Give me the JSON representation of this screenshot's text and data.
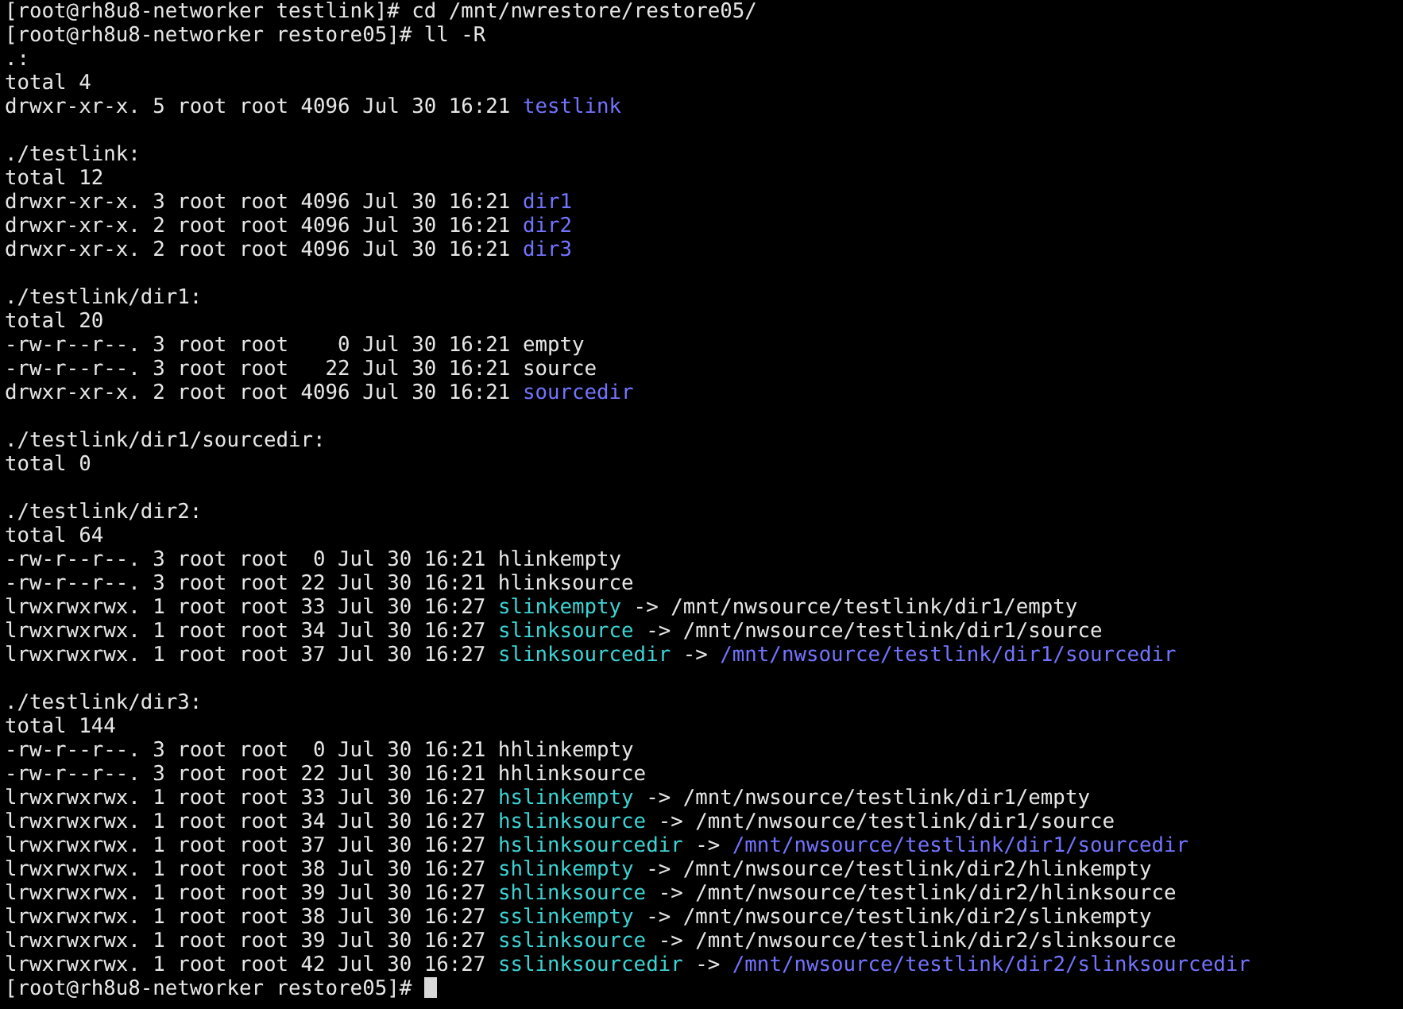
{
  "terminal": {
    "sections": [
      {
        "lines": [
          {
            "segments": [
              {
                "kind": "plain",
                "text": "[root@rh8u8-networker testlink]# cd /mnt/nwrestore/restore05/"
              }
            ]
          },
          {
            "segments": [
              {
                "kind": "plain",
                "text": "[root@rh8u8-networker restore05]# ll -R"
              }
            ]
          },
          {
            "segments": [
              {
                "kind": "plain",
                "text": ".:"
              }
            ]
          },
          {
            "segments": [
              {
                "kind": "plain",
                "text": "total 4"
              }
            ]
          },
          {
            "segments": [
              {
                "kind": "plain",
                "text": "drwxr-xr-x. 5 root root 4096 Jul 30 16:21 "
              },
              {
                "kind": "dir",
                "text": "testlink"
              }
            ]
          }
        ]
      },
      {
        "lines": [
          {
            "segments": [
              {
                "kind": "plain",
                "text": "./testlink:"
              }
            ]
          },
          {
            "segments": [
              {
                "kind": "plain",
                "text": "total 12"
              }
            ]
          },
          {
            "segments": [
              {
                "kind": "plain",
                "text": "drwxr-xr-x. 3 root root 4096 Jul 30 16:21 "
              },
              {
                "kind": "dir",
                "text": "dir1"
              }
            ]
          },
          {
            "segments": [
              {
                "kind": "plain",
                "text": "drwxr-xr-x. 2 root root 4096 Jul 30 16:21 "
              },
              {
                "kind": "dir",
                "text": "dir2"
              }
            ]
          },
          {
            "segments": [
              {
                "kind": "plain",
                "text": "drwxr-xr-x. 2 root root 4096 Jul 30 16:21 "
              },
              {
                "kind": "dir",
                "text": "dir3"
              }
            ]
          }
        ]
      },
      {
        "lines": [
          {
            "segments": [
              {
                "kind": "plain",
                "text": "./testlink/dir1:"
              }
            ]
          },
          {
            "segments": [
              {
                "kind": "plain",
                "text": "total 20"
              }
            ]
          },
          {
            "segments": [
              {
                "kind": "plain",
                "text": "-rw-r--r--. 3 root root    0 Jul 30 16:21 empty"
              }
            ]
          },
          {
            "segments": [
              {
                "kind": "plain",
                "text": "-rw-r--r--. 3 root root   22 Jul 30 16:21 source"
              }
            ]
          },
          {
            "segments": [
              {
                "kind": "plain",
                "text": "drwxr-xr-x. 2 root root 4096 Jul 30 16:21 "
              },
              {
                "kind": "dir",
                "text": "sourcedir"
              }
            ]
          }
        ]
      },
      {
        "lines": [
          {
            "segments": [
              {
                "kind": "plain",
                "text": "./testlink/dir1/sourcedir:"
              }
            ]
          },
          {
            "segments": [
              {
                "kind": "plain",
                "text": "total 0"
              }
            ]
          }
        ]
      },
      {
        "lines": [
          {
            "segments": [
              {
                "kind": "plain",
                "text": "./testlink/dir2:"
              }
            ]
          },
          {
            "segments": [
              {
                "kind": "plain",
                "text": "total 64"
              }
            ]
          },
          {
            "segments": [
              {
                "kind": "plain",
                "text": "-rw-r--r--. 3 root root  0 Jul 30 16:21 hlinkempty"
              }
            ]
          },
          {
            "segments": [
              {
                "kind": "plain",
                "text": "-rw-r--r--. 3 root root 22 Jul 30 16:21 hlinksource"
              }
            ]
          },
          {
            "segments": [
              {
                "kind": "plain",
                "text": "lrwxrwxrwx. 1 root root 33 Jul 30 16:27 "
              },
              {
                "kind": "link",
                "text": "slinkempty"
              },
              {
                "kind": "plain",
                "text": " -> /mnt/nwsource/testlink/dir1/empty"
              }
            ]
          },
          {
            "segments": [
              {
                "kind": "plain",
                "text": "lrwxrwxrwx. 1 root root 34 Jul 30 16:27 "
              },
              {
                "kind": "link",
                "text": "slinksource"
              },
              {
                "kind": "plain",
                "text": " -> /mnt/nwsource/testlink/dir1/source"
              }
            ]
          },
          {
            "segments": [
              {
                "kind": "plain",
                "text": "lrwxrwxrwx. 1 root root 37 Jul 30 16:27 "
              },
              {
                "kind": "link",
                "text": "slinksourcedir"
              },
              {
                "kind": "plain",
                "text": " -> "
              },
              {
                "kind": "dir",
                "text": "/mnt/nwsource/testlink/dir1/sourcedir"
              }
            ]
          }
        ]
      },
      {
        "lines": [
          {
            "segments": [
              {
                "kind": "plain",
                "text": "./testlink/dir3:"
              }
            ]
          },
          {
            "segments": [
              {
                "kind": "plain",
                "text": "total 144"
              }
            ]
          },
          {
            "segments": [
              {
                "kind": "plain",
                "text": "-rw-r--r--. 3 root root  0 Jul 30 16:21 hhlinkempty"
              }
            ]
          },
          {
            "segments": [
              {
                "kind": "plain",
                "text": "-rw-r--r--. 3 root root 22 Jul 30 16:21 hhlinksource"
              }
            ]
          },
          {
            "segments": [
              {
                "kind": "plain",
                "text": "lrwxrwxrwx. 1 root root 33 Jul 30 16:27 "
              },
              {
                "kind": "link",
                "text": "hslinkempty"
              },
              {
                "kind": "plain",
                "text": " -> /mnt/nwsource/testlink/dir1/empty"
              }
            ]
          },
          {
            "segments": [
              {
                "kind": "plain",
                "text": "lrwxrwxrwx. 1 root root 34 Jul 30 16:27 "
              },
              {
                "kind": "link",
                "text": "hslinksource"
              },
              {
                "kind": "plain",
                "text": " -> /mnt/nwsource/testlink/dir1/source"
              }
            ]
          },
          {
            "segments": [
              {
                "kind": "plain",
                "text": "lrwxrwxrwx. 1 root root 37 Jul 30 16:27 "
              },
              {
                "kind": "link",
                "text": "hslinksourcedir"
              },
              {
                "kind": "plain",
                "text": " -> "
              },
              {
                "kind": "dir",
                "text": "/mnt/nwsource/testlink/dir1/sourcedir"
              }
            ]
          },
          {
            "segments": [
              {
                "kind": "plain",
                "text": "lrwxrwxrwx. 1 root root 38 Jul 30 16:27 "
              },
              {
                "kind": "link",
                "text": "shlinkempty"
              },
              {
                "kind": "plain",
                "text": " -> /mnt/nwsource/testlink/dir2/hlinkempty"
              }
            ]
          },
          {
            "segments": [
              {
                "kind": "plain",
                "text": "lrwxrwxrwx. 1 root root 39 Jul 30 16:27 "
              },
              {
                "kind": "link",
                "text": "shlinksource"
              },
              {
                "kind": "plain",
                "text": " -> /mnt/nwsource/testlink/dir2/hlinksource"
              }
            ]
          },
          {
            "segments": [
              {
                "kind": "plain",
                "text": "lrwxrwxrwx. 1 root root 38 Jul 30 16:27 "
              },
              {
                "kind": "link",
                "text": "sslinkempty"
              },
              {
                "kind": "plain",
                "text": " -> /mnt/nwsource/testlink/dir2/slinkempty"
              }
            ]
          },
          {
            "segments": [
              {
                "kind": "plain",
                "text": "lrwxrwxrwx. 1 root root 39 Jul 30 16:27 "
              },
              {
                "kind": "link",
                "text": "sslinksource"
              },
              {
                "kind": "plain",
                "text": " -> /mnt/nwsource/testlink/dir2/slinksource"
              }
            ]
          },
          {
            "segments": [
              {
                "kind": "plain",
                "text": "lrwxrwxrwx. 1 root root 42 Jul 30 16:27 "
              },
              {
                "kind": "link",
                "text": "sslinksourcedir"
              },
              {
                "kind": "plain",
                "text": " -> "
              },
              {
                "kind": "dir",
                "text": "/mnt/nwsource/testlink/dir2/slinksourcedir"
              }
            ]
          }
        ]
      }
    ],
    "prompt": {
      "text": "[root@rh8u8-networker restore05]# ",
      "cursor": true
    }
  }
}
